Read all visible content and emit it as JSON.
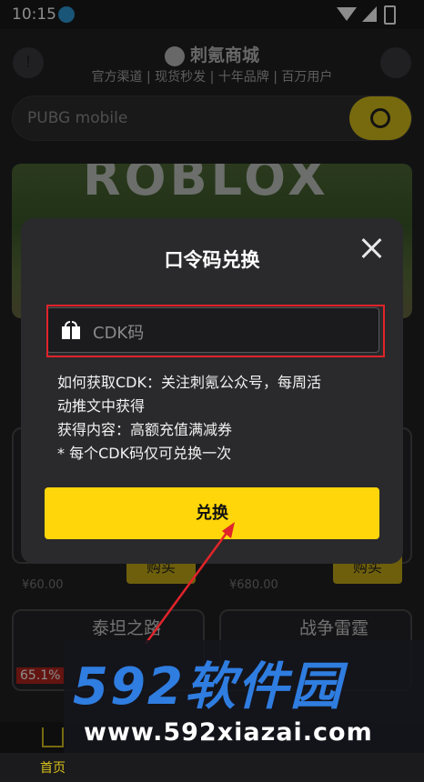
{
  "status_bar": {
    "time": "10:15"
  },
  "header": {
    "brand": "刺氪商城",
    "tagline": "官方渠道 | 现货秒发 | 十年品牌 | 百万用户",
    "left_icon": "warning-icon",
    "right_icon": "support-icon"
  },
  "search": {
    "value": "PUBG mobile",
    "button_icon": "search-icon"
  },
  "banner": {
    "text": "ROBLOX"
  },
  "background_cards": [
    {
      "old_price": "¥60.00",
      "buy_label": "购买"
    },
    {
      "old_price": "¥680.00",
      "buy_label": "购买"
    },
    {
      "title": "泰坦之路",
      "badge": "65.1%"
    },
    {
      "title": "战争雷霆"
    }
  ],
  "modal": {
    "title": "口令码兑换",
    "input_placeholder": "CDK码",
    "info_lines": [
      "如何获取CDK：关注刺氪公众号，每周活",
      "动推文中获得",
      "获得内容：高额充值满减券",
      "* 每个CDK码仅可兑换一次"
    ],
    "redeem_label": "兑换"
  },
  "tabbar": {
    "home_label": "首页"
  },
  "watermark": {
    "logo": "592软件园",
    "url": "www.592xiazai.com"
  },
  "colors": {
    "accent": "#ffd60a",
    "highlight": "#e0242a",
    "dark_bg": "#1b1b1d"
  }
}
